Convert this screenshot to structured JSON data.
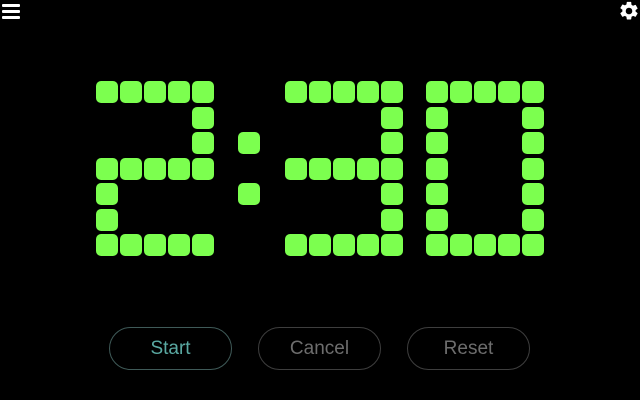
{
  "toolbar": {
    "menu_icon": "hamburger-menu-icon",
    "settings_icon": "gear-icon"
  },
  "timer": {
    "minutes": "2",
    "separator": ":",
    "seconds": "30",
    "digit_color": "#7cff4f"
  },
  "controls": {
    "start_label": "Start",
    "cancel_label": "Cancel",
    "reset_label": "Reset",
    "start_color": "#5aa9a2",
    "inactive_color": "#6d6d6d"
  }
}
